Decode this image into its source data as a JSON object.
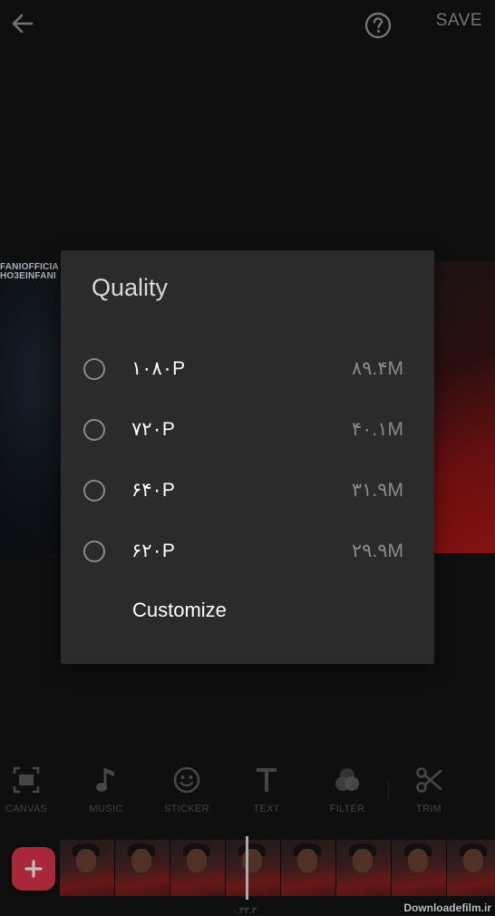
{
  "header": {
    "save_label": "SAVE"
  },
  "preview": {
    "watermark_line1": "FANIOFFICIA",
    "watermark_line2": "HO3EINFANI"
  },
  "dialog": {
    "title": "Quality",
    "options": [
      {
        "label": "۱۰۸۰P",
        "size": "۸۹.۴M",
        "selected": false
      },
      {
        "label": "۷۲۰P",
        "size": "۴۰.۱M",
        "selected": false
      },
      {
        "label": "۶۴۰P",
        "size": "۳۱.۹M",
        "selected": false
      },
      {
        "label": "۶۲۰P",
        "size": "۲۹.۹M",
        "selected": false
      }
    ],
    "customize_label": "Customize"
  },
  "toolbar": {
    "tools": [
      {
        "label": "CANVAS",
        "icon": "canvas-icon"
      },
      {
        "label": "MUSIC",
        "icon": "music-note-icon"
      },
      {
        "label": "STICKER",
        "icon": "smiley-icon"
      },
      {
        "label": "TEXT",
        "icon": "text-t-icon"
      },
      {
        "label": "FILTER",
        "icon": "filter-circles-icon"
      },
      {
        "label": "TRIM",
        "icon": "scissors-icon"
      }
    ]
  },
  "timeline": {
    "timecode": "۰:۳۳.۳"
  },
  "colors": {
    "accent": "#e0364c",
    "dialog_bg": "#2b2b2b",
    "background": "#141414"
  },
  "site_watermark": "Downloadefilm.ir"
}
